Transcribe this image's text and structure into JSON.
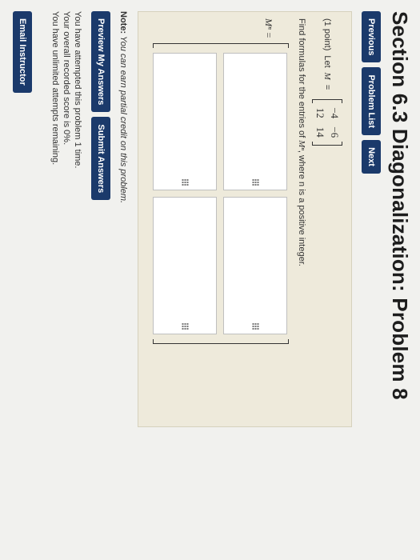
{
  "page": {
    "title": "Section 6.3 Diagonalization: Problem 8"
  },
  "nav": {
    "previous": "Previous",
    "problem_list": "Problem List",
    "next": "Next"
  },
  "problem": {
    "points": "(1 point)",
    "let_text": "Let",
    "var_M": "M",
    "equals": "=",
    "matrix": [
      "−4",
      "−6",
      "12",
      "14"
    ],
    "instruction_prefix": "Find formulas for the entries of",
    "Mn": "Mⁿ",
    "instruction_suffix": ", where n is a positive integer.",
    "lhs": "Mⁿ ="
  },
  "answers": {
    "cells": [
      "",
      "",
      "",
      ""
    ]
  },
  "note": {
    "label": "Note:",
    "text": "You can earn partial credit on this problem."
  },
  "actions": {
    "preview": "Preview My Answers",
    "submit": "Submit Answers"
  },
  "status": {
    "attempts": "You have attempted this problem 1 time.",
    "score": "Your overall recorded score is 0%.",
    "remaining": "You have unlimited attempts remaining."
  },
  "footer": {
    "email": "Email Instructor"
  }
}
